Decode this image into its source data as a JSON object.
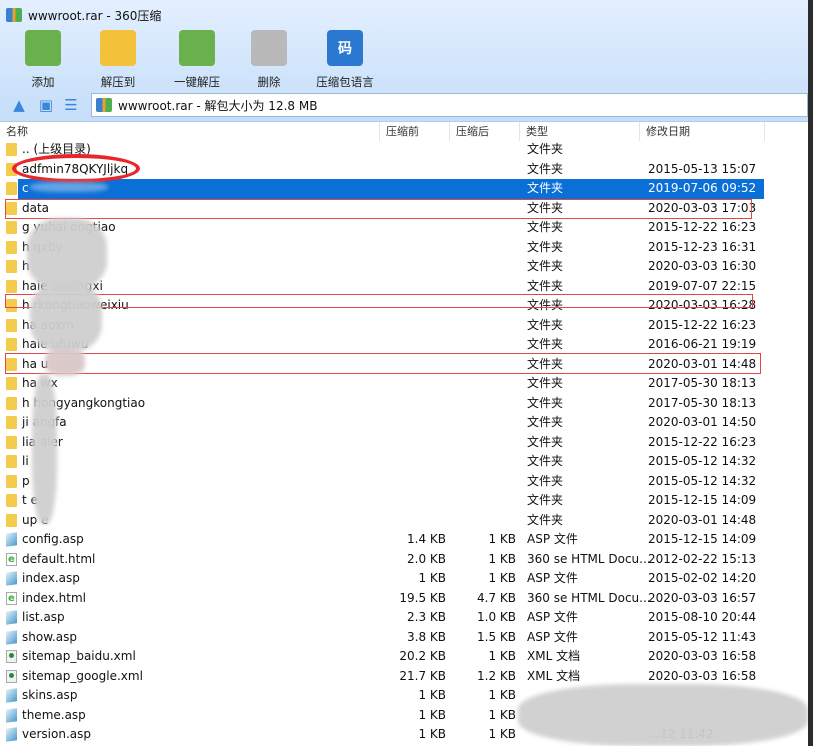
{
  "window": {
    "title": "wwwroot.rar - 360压缩"
  },
  "toolbar": [
    {
      "label": "添加",
      "icon": "add-archive-icon",
      "color": "#6ab04c"
    },
    {
      "label": "解压到",
      "icon": "extract-to-folder-icon",
      "color": "#f3c23a"
    },
    {
      "label": "一键解压",
      "icon": "one-click-extract-icon",
      "color": "#6ab04c"
    },
    {
      "label": "删除",
      "icon": "trash-icon",
      "color": "#b9b9b9"
    },
    {
      "label": "压缩包语言",
      "icon": "language-code-icon",
      "color": "#2a78d0",
      "glyph": "码"
    }
  ],
  "address": {
    "text": "wwwroot.rar - 解包大小为 12.8 MB"
  },
  "columns": {
    "name": "名称",
    "size": "压缩前",
    "packed": "压缩后",
    "type": "类型",
    "date": "修改日期"
  },
  "rows": [
    {
      "name": ".. (上级目录)",
      "size": "",
      "packed": "",
      "type": "文件夹",
      "date": "",
      "icon": "folder"
    },
    {
      "name": "adfmin78QKYJljkq",
      "size": "",
      "packed": "",
      "type": "文件夹",
      "date": "2015-05-13 15:07",
      "icon": "folder"
    },
    {
      "name": "c",
      "size": "",
      "packed": "",
      "type": "文件夹",
      "date": "2019-07-06 09:52",
      "icon": "folder",
      "selected": true
    },
    {
      "name": "data",
      "size": "",
      "packed": "",
      "type": "文件夹",
      "date": "2020-03-03 17:03",
      "icon": "folder"
    },
    {
      "name": "g      yuhai    ongtiao",
      "size": "",
      "packed": "",
      "type": "文件夹",
      "date": "2015-12-22 16:23",
      "icon": "folder"
    },
    {
      "name": "h                 qxby",
      "size": "",
      "packed": "",
      "type": "文件夹",
      "date": "2015-12-23 16:31",
      "icon": "folder"
    },
    {
      "name": "h",
      "size": "",
      "packed": "",
      "type": "文件夹",
      "date": "2020-03-03 16:30",
      "icon": "folder"
    },
    {
      "name": "haie         aoqingxi",
      "size": "",
      "packed": "",
      "type": "文件夹",
      "date": "2019-07-07 22:15",
      "icon": "folder"
    },
    {
      "name": "h    rkongtiaoweixiu",
      "size": "",
      "packed": "",
      "type": "文件夹",
      "date": "2020-03-03 16:28",
      "icon": "folder"
    },
    {
      "name": "ha             aoxm",
      "size": "",
      "packed": "",
      "type": "文件夹",
      "date": "2015-12-22 16:23",
      "icon": "folder"
    },
    {
      "name": "haie          ufuwu",
      "size": "",
      "packed": "",
      "type": "文件夹",
      "date": "2016-06-21 19:19",
      "icon": "folder"
    },
    {
      "name": "ha             u",
      "size": "",
      "packed": "",
      "type": "文件夹",
      "date": "2020-03-01 14:48",
      "icon": "folder"
    },
    {
      "name": "ha    wx",
      "size": "",
      "packed": "",
      "type": "文件夹",
      "date": "2017-05-30 18:13",
      "icon": "folder"
    },
    {
      "name": "h        hongyangkongtiao",
      "size": "",
      "packed": "",
      "type": "文件夹",
      "date": "2017-05-30 18:13",
      "icon": "folder"
    },
    {
      "name": "ji      angfa",
      "size": "",
      "packed": "",
      "type": "文件夹",
      "date": "2020-03-01 14:50",
      "icon": "folder"
    },
    {
      "name": "lia      aier",
      "size": "",
      "packed": "",
      "type": "文件夹",
      "date": "2015-12-22 16:23",
      "icon": "folder"
    },
    {
      "name": "li",
      "size": "",
      "packed": "",
      "type": "文件夹",
      "date": "2015-05-12 14:32",
      "icon": "folder"
    },
    {
      "name": "p",
      "size": "",
      "packed": "",
      "type": "文件夹",
      "date": "2015-05-12 14:32",
      "icon": "folder"
    },
    {
      "name": "t     e",
      "size": "",
      "packed": "",
      "type": "文件夹",
      "date": "2015-12-15 14:09",
      "icon": "folder"
    },
    {
      "name": "up   e",
      "size": "",
      "packed": "",
      "type": "文件夹",
      "date": "2020-03-01 14:48",
      "icon": "folder"
    },
    {
      "name": "config.asp",
      "size": "1.4 KB",
      "packed": "1 KB",
      "type": "ASP 文件",
      "date": "2015-12-15 14:09",
      "icon": "asp"
    },
    {
      "name": "default.html",
      "size": "2.0 KB",
      "packed": "1 KB",
      "type": "360 se HTML Docu...",
      "date": "2012-02-22 15:13",
      "icon": "html"
    },
    {
      "name": "index.asp",
      "size": "1 KB",
      "packed": "1 KB",
      "type": "ASP 文件",
      "date": "2015-02-02 14:20",
      "icon": "asp"
    },
    {
      "name": "index.html",
      "size": "19.5 KB",
      "packed": "4.7 KB",
      "type": "360 se HTML Docu...",
      "date": "2020-03-03 16:57",
      "icon": "html"
    },
    {
      "name": "list.asp",
      "size": "2.3 KB",
      "packed": "1.0 KB",
      "type": "ASP 文件",
      "date": "2015-08-10 20:44",
      "icon": "asp"
    },
    {
      "name": "show.asp",
      "size": "3.8 KB",
      "packed": "1.5 KB",
      "type": "ASP 文件",
      "date": "2015-05-12 11:43",
      "icon": "asp"
    },
    {
      "name": "sitemap_baidu.xml",
      "size": "20.2 KB",
      "packed": "1 KB",
      "type": "XML 文档",
      "date": "2020-03-03 16:58",
      "icon": "xml"
    },
    {
      "name": "sitemap_google.xml",
      "size": "21.7 KB",
      "packed": "1.2 KB",
      "type": "XML 文档",
      "date": "2020-03-03 16:58",
      "icon": "xml"
    },
    {
      "name": "skins.asp",
      "size": "1 KB",
      "packed": "1 KB",
      "type": "",
      "date": "",
      "icon": "asp"
    },
    {
      "name": "theme.asp",
      "size": "1 KB",
      "packed": "1 KB",
      "type": "",
      "date": "",
      "icon": "asp"
    },
    {
      "name": "version.asp",
      "size": "1 KB",
      "packed": "1 KB",
      "type": "",
      "date": "…12 11:42",
      "icon": "asp"
    }
  ],
  "colors": {
    "selection": "#0a6fd6",
    "annotation": "#e8272a"
  }
}
